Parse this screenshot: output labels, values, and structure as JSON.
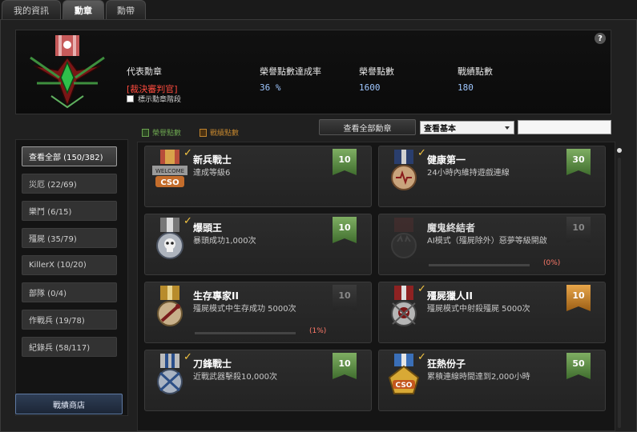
{
  "tabs": [
    {
      "label": "我的資訊"
    },
    {
      "label": "勳章"
    },
    {
      "label": "勳帶"
    }
  ],
  "header": {
    "representative_label": "代表勳章",
    "representative_value": "[裁決審判官]",
    "honor_rate_label": "榮譽點數達成率",
    "honor_rate_value": "36 %",
    "honor_points_label": "榮譽點數",
    "honor_points_value": "1600",
    "combat_points_label": "戰績點數",
    "combat_points_value": "180",
    "show_stage_label": "標示勳章階段",
    "help_label": "?"
  },
  "legend": {
    "honor_label": "榮譽點數",
    "combat_label": "戰績點數",
    "honor_color": "#6ba34f",
    "combat_color": "#c0842e"
  },
  "toolbar": {
    "view_all_button": "查看全部勳章",
    "filter_value": "查看基本",
    "search_value": ""
  },
  "sidebar": {
    "items": [
      {
        "label": "查看全部 (150/382)"
      },
      {
        "label": "災厄 (22/69)"
      },
      {
        "label": "樂鬥 (6/15)"
      },
      {
        "label": "殭屍 (35/79)"
      },
      {
        "label": "KillerX (10/20)"
      },
      {
        "label": "部隊 (0/4)"
      },
      {
        "label": "作戰兵 (19/78)"
      },
      {
        "label": "紀錄兵 (58/117)"
      }
    ],
    "shop_button": "戰績商店"
  },
  "medals": [
    {
      "title": "新兵戰士",
      "desc": "達成等級6",
      "badge": "10",
      "badge_type": "green",
      "checked": true,
      "icon": "welcome-medal-icon"
    },
    {
      "title": "健康第一",
      "desc": "24小時內維持遊戲連線",
      "badge": "30",
      "badge_type": "green",
      "checked": true,
      "icon": "heart-medal-icon"
    },
    {
      "title": "爆頭王",
      "desc": "暴頭成功1,000次",
      "badge": "10",
      "badge_type": "green",
      "checked": true,
      "icon": "skull-medal-icon"
    },
    {
      "title": "魔鬼終結者",
      "desc": "AI模式（殭屍除外）惡夢等級開啟",
      "badge": "10",
      "badge_type": "grey",
      "checked": false,
      "icon": "devil-medal-icon",
      "progress": 0,
      "progress_text": "(0%)"
    },
    {
      "title": "生存專家II",
      "desc": "殭屍模式中生存成功 5000次",
      "badge": "10",
      "badge_type": "grey",
      "checked": false,
      "icon": "survivor-medal-icon",
      "progress": 0.01,
      "progress_text": "(1%)"
    },
    {
      "title": "殭屍獵人II",
      "desc": "殭屍模式中射殺殭屍 5000次",
      "badge": "10",
      "badge_type": "gold",
      "checked": true,
      "icon": "zombie-hunter-medal-icon"
    },
    {
      "title": "刀鋒戰士",
      "desc": "近戰武器擊殺10,000次",
      "badge": "10",
      "badge_type": "green",
      "checked": true,
      "icon": "blade-medal-icon"
    },
    {
      "title": "狂熱份子",
      "desc": "累積連線時間達到2,000小時",
      "badge": "50",
      "badge_type": "green",
      "checked": true,
      "icon": "fanatic-medal-icon"
    }
  ]
}
